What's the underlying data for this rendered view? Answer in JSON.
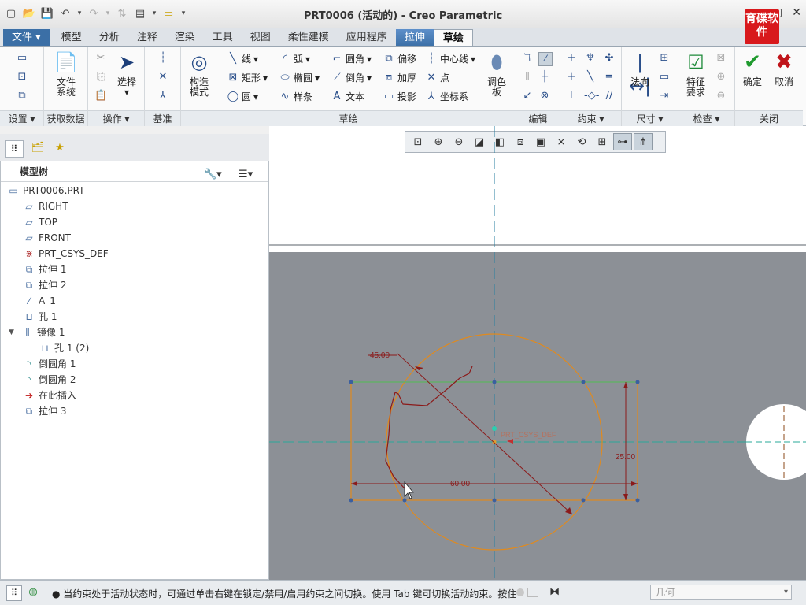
{
  "window": {
    "title": "PRT0006 (活动的) - Creo Parametric",
    "logo_text": "育碟软件"
  },
  "quick_access": [
    "new-icon",
    "open-icon",
    "save-icon",
    "undo-icon",
    "redo-icon",
    "regenerate-icon",
    "windows-icon",
    "close-icon",
    "customize-icon"
  ],
  "menu_tabs": [
    {
      "label": "文件"
    },
    {
      "label": "模型"
    },
    {
      "label": "分析"
    },
    {
      "label": "注释"
    },
    {
      "label": "渲染"
    },
    {
      "label": "工具"
    },
    {
      "label": "视图"
    },
    {
      "label": "柔性建模"
    },
    {
      "label": "应用程序"
    },
    {
      "label": "拉伸"
    },
    {
      "label": "草绘"
    }
  ],
  "ribbon": {
    "groups": {
      "settings": "设置",
      "get_data": "获取数据",
      "operations": "操作",
      "datum": "基准",
      "sketch": "草绘",
      "edit": "编辑",
      "constrain": "约束",
      "dimension": "尺寸",
      "inspect": "检查",
      "close": "关闭"
    },
    "file_system": "文件\n系统",
    "select": "选择",
    "construction_mode": "构造\n模式",
    "line": "线",
    "arc": "弧",
    "fillet": "圆角",
    "offset": "偏移",
    "centerline": "中心线",
    "rectangle": "矩形",
    "ellipse": "椭圆",
    "chamfer": "倒角",
    "thicken": "加厚",
    "point": "点",
    "circle": "圆",
    "spline": "样条",
    "text": "文本",
    "project": "投影",
    "coordinate_system": "坐标系",
    "palette": "调色\n板",
    "normal": "法向",
    "feature_requirements": "特征\n要求",
    "ok": "确定",
    "cancel": "取消"
  },
  "model_tree": {
    "header": "模型树",
    "items": [
      {
        "label": "PRT0006.PRT",
        "icon": "part-icon"
      },
      {
        "label": "RIGHT",
        "icon": "datum-plane-icon"
      },
      {
        "label": "TOP",
        "icon": "datum-plane-icon"
      },
      {
        "label": "FRONT",
        "icon": "datum-plane-icon"
      },
      {
        "label": "PRT_CSYS_DEF",
        "icon": "csys-icon"
      },
      {
        "label": "拉伸 1",
        "icon": "extrude-icon"
      },
      {
        "label": "拉伸 2",
        "icon": "extrude-icon"
      },
      {
        "label": "A_1",
        "icon": "axis-icon"
      },
      {
        "label": "孔 1",
        "icon": "hole-icon"
      },
      {
        "label": "镜像 1",
        "icon": "mirror-icon"
      },
      {
        "label": "孔 1 (2)",
        "icon": "hole-icon"
      },
      {
        "label": "倒圆角 1",
        "icon": "round-icon"
      },
      {
        "label": "倒圆角 2",
        "icon": "round-icon"
      },
      {
        "label": "在此插入",
        "icon": "insert-arrow-icon"
      },
      {
        "label": "拉伸 3",
        "icon": "extrude-new-icon"
      }
    ]
  },
  "sketch": {
    "dim_angle": "45.00",
    "dim_width": "60.00",
    "dim_height": "25.00",
    "csys_label": "PRT_CSYS_DEF",
    "colors": {
      "circle": "#e08a1e",
      "dim": "#8b1a1a",
      "centerline": "#2aa89a",
      "dash": "#2a7fa0"
    }
  },
  "status": {
    "message": "● 当约束处于活动状态时，可通过单击右键在锁定/禁用/启用约束之间切换。使用 Tab 键可切换活动约束。按住",
    "filter_placeholder": "几何"
  }
}
